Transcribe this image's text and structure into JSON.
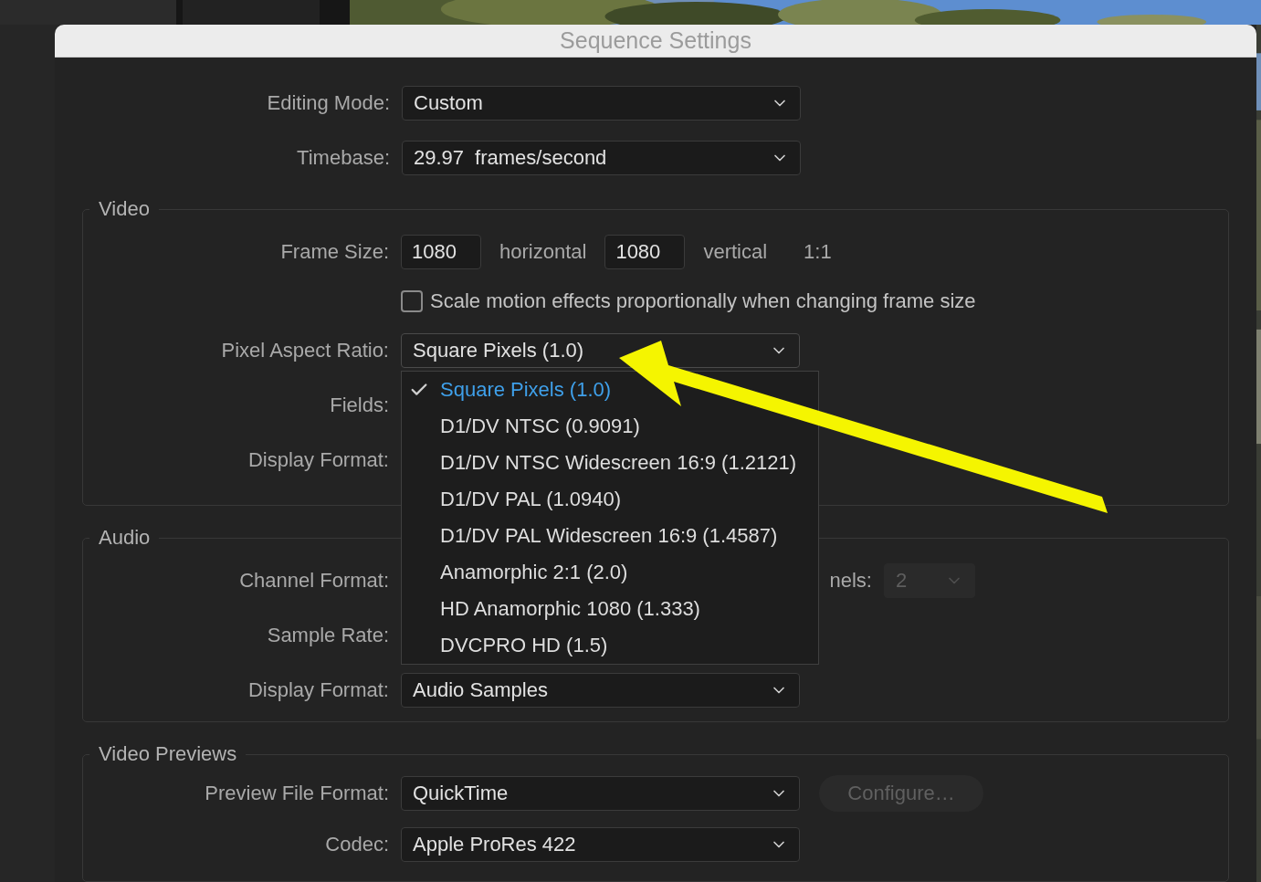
{
  "window": {
    "title": "Sequence Settings"
  },
  "general": [
    {
      "label": "Editing Mode:",
      "value": "Custom"
    },
    {
      "label": "Timebase:",
      "value": "29.97",
      "unit": "frames/second"
    }
  ],
  "video": {
    "title": "Video",
    "frame_size": {
      "label": "Frame Size:",
      "horizontal": "1080",
      "horizontal_label": "horizontal",
      "vertical": "1080",
      "vertical_label": "vertical",
      "ratio": "1:1"
    },
    "scale_option": {
      "label": "Scale motion effects proportionally when changing frame size",
      "checked": false
    },
    "pixel_aspect": {
      "label": "Pixel Aspect Ratio:",
      "value": "Square Pixels (1.0)",
      "expanded": true,
      "options": [
        {
          "label": "Square Pixels (1.0)",
          "selected": true
        },
        {
          "label": "D1/DV NTSC (0.9091)",
          "selected": false
        },
        {
          "label": "D1/DV NTSC Widescreen 16:9 (1.2121)",
          "selected": false
        },
        {
          "label": "D1/DV PAL (1.0940)",
          "selected": false
        },
        {
          "label": "D1/DV PAL Widescreen 16:9 (1.4587)",
          "selected": false
        },
        {
          "label": "Anamorphic 2:1 (2.0)",
          "selected": false
        },
        {
          "label": "HD Anamorphic 1080 (1.333)",
          "selected": false
        },
        {
          "label": "DVCPRO HD (1.5)",
          "selected": false
        }
      ]
    },
    "fields": {
      "label": "Fields:"
    },
    "display_format": {
      "label": "Display Format:"
    }
  },
  "audio": {
    "title": "Audio",
    "channel_format": {
      "label": "Channel Format:"
    },
    "channels": {
      "label": "nels:",
      "value": "2",
      "disabled": true
    },
    "sample_rate": {
      "label": "Sample Rate:"
    },
    "display_format": {
      "label": "Display Format:",
      "value": "Audio Samples"
    }
  },
  "video_previews": {
    "title": "Video Previews",
    "preview_file_format": {
      "label": "Preview File Format:",
      "value": "QuickTime"
    },
    "configure_button": {
      "label": "Configure…",
      "disabled": true
    },
    "codec": {
      "label": "Codec:",
      "value": "Apple ProRes 422"
    }
  }
}
